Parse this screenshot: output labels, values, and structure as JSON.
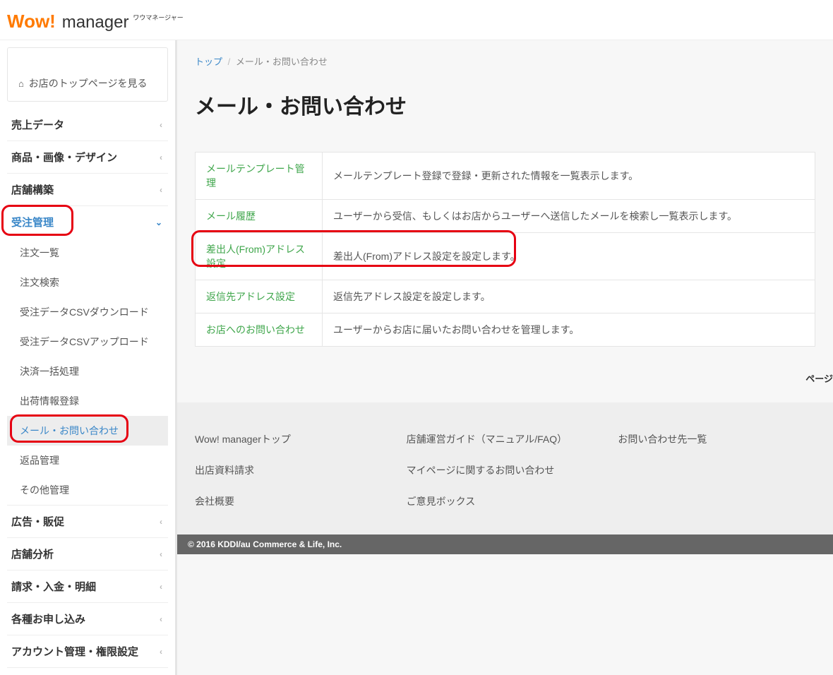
{
  "app": {
    "logo_wow": "Wow!",
    "logo_manager": "manager",
    "logo_small": "ワウマネージャー"
  },
  "side_top_link": "お店のトップページを見る",
  "nav": [
    {
      "label": "売上データ",
      "open": false
    },
    {
      "label": "商品・画像・デザイン",
      "open": false
    },
    {
      "label": "店舗構築",
      "open": false
    },
    {
      "label": "受注管理",
      "open": true,
      "active": true,
      "items": [
        {
          "label": "注文一覧"
        },
        {
          "label": "注文検索"
        },
        {
          "label": "受注データCSVダウンロード"
        },
        {
          "label": "受注データCSVアップロード"
        },
        {
          "label": "決済一括処理"
        },
        {
          "label": "出荷情報登録"
        },
        {
          "label": "メール・お問い合わせ",
          "active": true
        },
        {
          "label": "返品管理"
        },
        {
          "label": "その他管理"
        }
      ]
    },
    {
      "label": "広告・販促",
      "open": false
    },
    {
      "label": "店舗分析",
      "open": false
    },
    {
      "label": "請求・入金・明細",
      "open": false
    },
    {
      "label": "各種お申し込み",
      "open": false
    },
    {
      "label": "アカウント管理・権限設定",
      "open": false
    }
  ],
  "breadcrumb": {
    "root": "トップ",
    "current": "メール・お問い合わせ"
  },
  "page_title": "メール・お問い合わせ",
  "table": [
    {
      "label": "メールテンプレート管理",
      "desc": "メールテンプレート登録で登録・更新された情報を一覧表示します。"
    },
    {
      "label": "メール履歴",
      "desc": "ユーザーから受信、もしくはお店からユーザーへ送信したメールを検索し一覧表示します。"
    },
    {
      "label": "差出人(From)アドレス設定",
      "desc": "差出人(From)アドレス設定を設定します。",
      "highlight": true
    },
    {
      "label": "返信先アドレス設定",
      "desc": "返信先アドレス設定を設定します。"
    },
    {
      "label": "お店へのお問い合わせ",
      "desc": "ユーザーからお店に届いたお問い合わせを管理します。"
    }
  ],
  "page_foot": "ページ",
  "footer": {
    "cols": [
      [
        "Wow! managerトップ",
        "出店資料請求",
        "会社概要"
      ],
      [
        "店舗運営ガイド（マニュアル/FAQ）",
        "マイページに関するお問い合わせ",
        "ご意見ボックス"
      ],
      [
        "お問い合わせ先一覧"
      ]
    ],
    "copyright": "© 2016 KDDI/au Commerce & Life, Inc."
  }
}
